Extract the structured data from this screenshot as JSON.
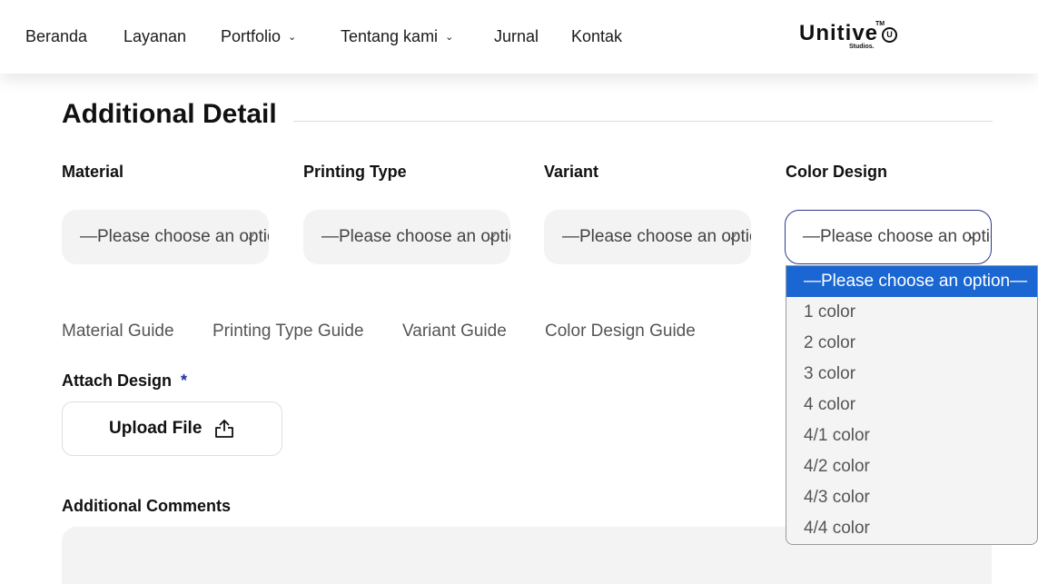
{
  "nav": {
    "items": [
      {
        "label": "Beranda",
        "dropdown": false
      },
      {
        "label": "Layanan",
        "dropdown": false
      },
      {
        "label": "Portfolio",
        "dropdown": true
      },
      {
        "label": "Tentang kami",
        "dropdown": true
      },
      {
        "label": "Jurnal",
        "dropdown": false
      },
      {
        "label": "Kontak",
        "dropdown": false
      }
    ],
    "logo": {
      "word": "Unitive",
      "tm": "TM",
      "sub": "Studios.",
      "mark": "U"
    }
  },
  "section": {
    "title": "Additional Detail"
  },
  "fields": [
    {
      "label": "Material",
      "value": "—Please choose an option—"
    },
    {
      "label": "Printing Type",
      "value": "—Please choose an option—"
    },
    {
      "label": "Variant",
      "value": "—Please choose an option—"
    },
    {
      "label": "Color Design",
      "value": "—Please choose an option—"
    }
  ],
  "guides": [
    "Material Guide",
    "Printing Type Guide",
    "Variant Guide",
    "Color Design Guide"
  ],
  "attach": {
    "label": "Attach Design",
    "required": "*",
    "button": "Upload File"
  },
  "comments": {
    "label": "Additional Comments",
    "value": ""
  },
  "dropdown": {
    "options": [
      "—Please choose an option—",
      "1 color",
      "2 color",
      "3 color",
      "4 color",
      "4/1 color",
      "4/2 color",
      "4/3 color",
      "4/4 color"
    ],
    "selected_index": 0
  },
  "colors": {
    "accent": "#1a66d2",
    "focus_border": "#2b3a8c",
    "required": "#1f2f9e",
    "field_bg": "#f3f3f3"
  }
}
